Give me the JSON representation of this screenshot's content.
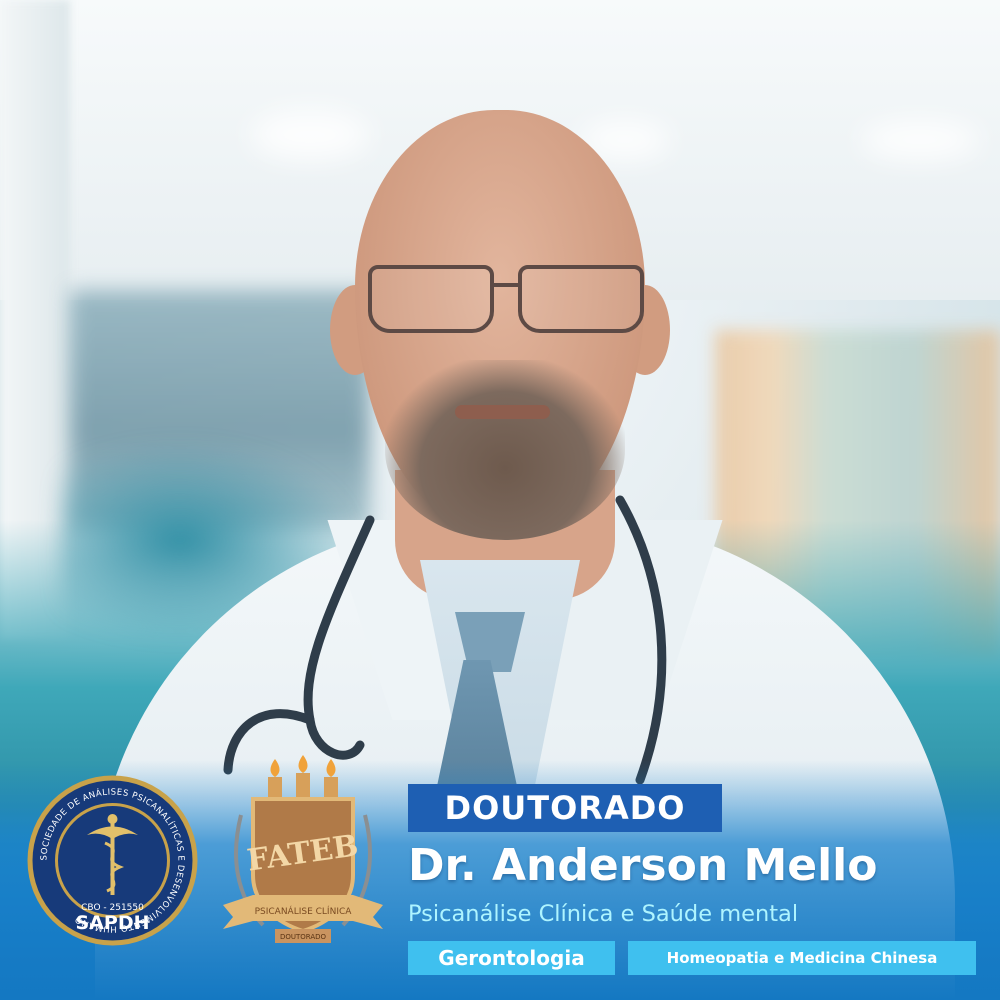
{
  "badge": {
    "label": "DOUTORADO"
  },
  "doctor": {
    "name": "Dr. Anderson Mello",
    "specialty": "Psicanálise Clínica e Saúde mental"
  },
  "tags": [
    {
      "label": "Gerontologia"
    },
    {
      "label": "Homeopatia e Medicina Chinesa"
    }
  ],
  "seals": {
    "sapdh": {
      "ring_text": "SOCIEDADE DE ANÁLISES PSICANALÍTICAS E DESENVOLVIMENTO HUMANO",
      "cbo": "CBO - 251550",
      "acronym": "SAPDH",
      "colors": {
        "ring": "#c8a24a",
        "field": "#173a7a"
      }
    },
    "fateb": {
      "acronym": "FATEB",
      "ribbon": "PSICANÁLISE CLÍNICA",
      "footer": "DOUTORADO",
      "colors": {
        "shield": "#b07a48",
        "gold": "#e2b978"
      }
    }
  },
  "colors": {
    "badge_bg": "#1e5fb3",
    "chip_bg": "#3fc0ef",
    "subtitle": "#aef4ff",
    "bottom_blue": "#1478c2"
  }
}
